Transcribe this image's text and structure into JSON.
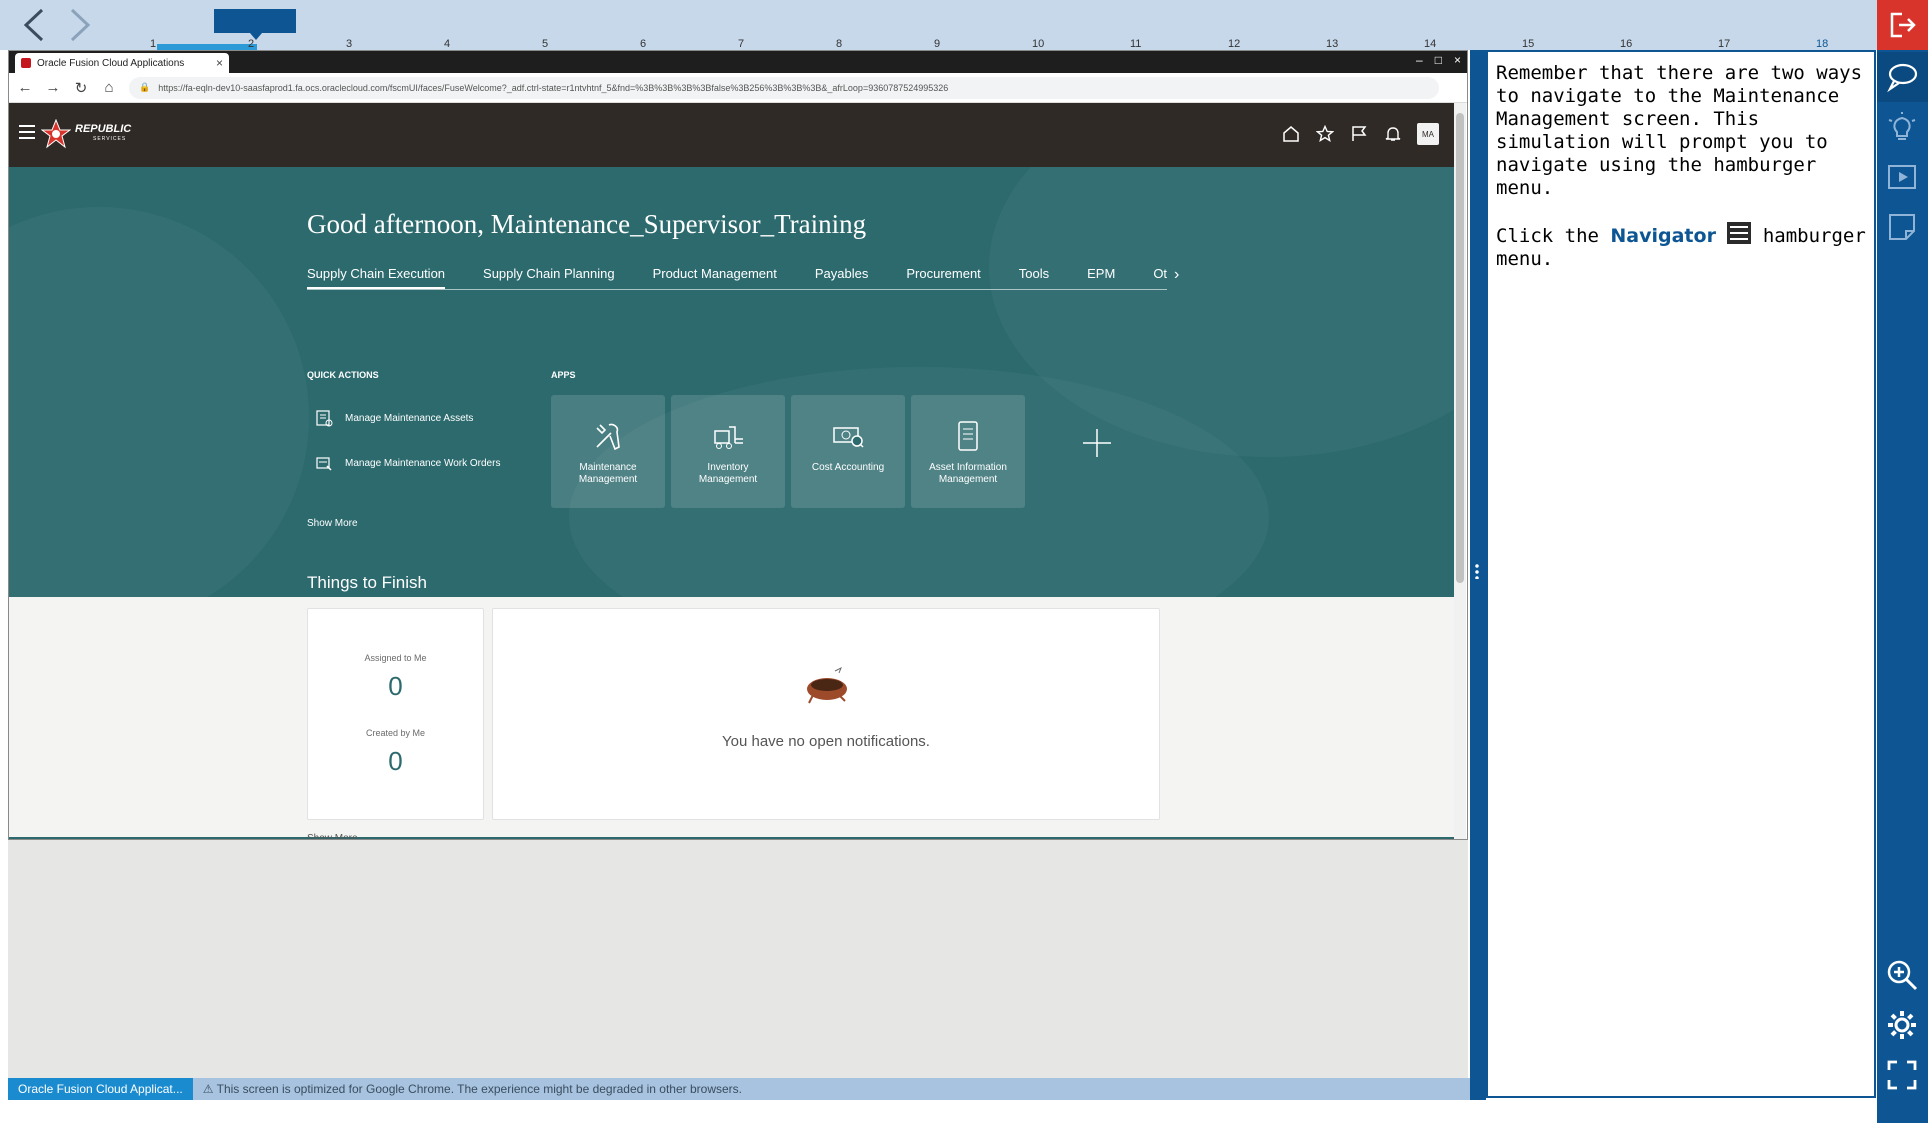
{
  "player": {
    "steps": [
      "1",
      "2",
      "3",
      "4",
      "5",
      "6",
      "7",
      "8",
      "9",
      "10",
      "11",
      "12",
      "13",
      "14",
      "15",
      "16",
      "17",
      "18"
    ]
  },
  "browser": {
    "tab_title": "Oracle Fusion Cloud Applications",
    "url": "https://fa-eqln-dev10-saasfaprod1.fa.ocs.oraclecloud.com/fscmUI/faces/FuseWelcome?_adf.ctrl-state=r1ntvhtnf_5&fnd=%3B%3B%3B%3Bfalse%3B256%3B%3B%3B&_afrLoop=9360787524995326"
  },
  "oracle": {
    "logo_text": "REPUBLIC",
    "logo_sub": "SERVICES",
    "avatar_initials": "MA",
    "greeting": "Good afternoon, Maintenance_Supervisor_Training",
    "tabs": [
      "Supply Chain Execution",
      "Supply Chain Planning",
      "Product Management",
      "Payables",
      "Procurement",
      "Tools",
      "EPM",
      "Oth"
    ],
    "quick_actions_label": "QUICK ACTIONS",
    "apps_label": "APPS",
    "quick_actions": [
      "Manage Maintenance Assets",
      "Manage Maintenance Work Orders"
    ],
    "show_more": "Show More",
    "apps": [
      {
        "label": "Maintenance Management",
        "icon": "tools-icon"
      },
      {
        "label": "Inventory Management",
        "icon": "forklift-icon"
      },
      {
        "label": "Cost Accounting",
        "icon": "money-icon"
      },
      {
        "label": "Asset Information Management",
        "icon": "document-icon"
      }
    ],
    "things_to_finish": "Things to Finish",
    "assigned_label": "Assigned to Me",
    "assigned_value": "0",
    "created_label": "Created by Me",
    "created_value": "0",
    "no_notifications": "You have no open notifications."
  },
  "status_bar": {
    "app_label": "Oracle Fusion Cloud Applicat...",
    "warning": "⚠ This screen is optimized for Google Chrome. The experience might be degraded in other browsers."
  },
  "instructions": {
    "para1": "Remember that there are two ways to navigate to the Maintenance Management screen. This simulation will prompt you to navigate using the hamburger menu.",
    "click_prefix": "Click the ",
    "navigator": "Navigator",
    "click_suffix": " hamburger menu."
  },
  "colors": {
    "accent": "#0d5693",
    "hero": "#2c6a6e",
    "exit": "#d9342b"
  }
}
